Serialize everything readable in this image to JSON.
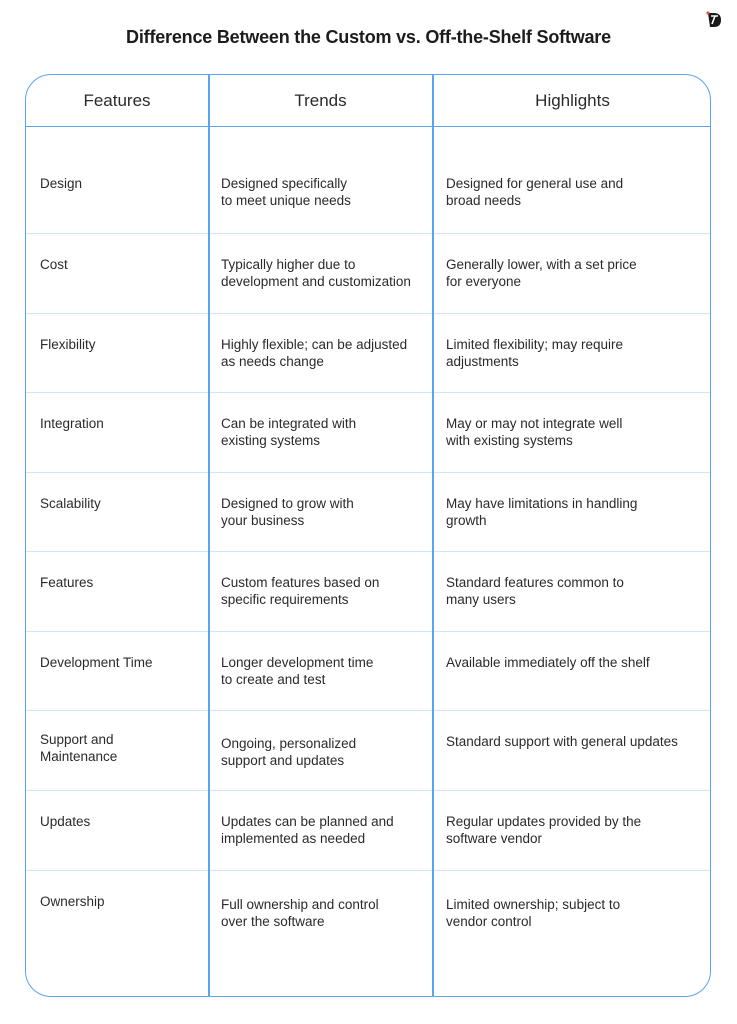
{
  "logo_icon": "brand-logo-icon",
  "title": "Difference Between the Custom vs. Off-the-Shelf Software",
  "columns": [
    "Features",
    "Trends",
    "Highlights"
  ],
  "rows": [
    {
      "feature": [
        "Design"
      ],
      "trend": [
        "Designed specifically",
        "to meet unique needs"
      ],
      "highlight": [
        "Designed for general use and",
        "broad needs"
      ]
    },
    {
      "feature": [
        "Cost"
      ],
      "trend": [
        "Typically higher due to",
        "development and customization"
      ],
      "highlight": [
        "Generally lower, with a set price",
        "for everyone"
      ]
    },
    {
      "feature": [
        "Flexibility"
      ],
      "trend": [
        "Highly flexible; can be adjusted",
        "as needs change"
      ],
      "highlight": [
        "Limited flexibility; may require",
        "adjustments"
      ]
    },
    {
      "feature": [
        "Integration"
      ],
      "trend": [
        "Can be integrated with",
        "existing systems"
      ],
      "highlight": [
        "May or may not integrate well",
        "with existing systems"
      ]
    },
    {
      "feature": [
        "Scalability"
      ],
      "trend": [
        "Designed to grow with",
        "your business"
      ],
      "highlight": [
        "May have limitations in handling",
        "growth"
      ]
    },
    {
      "feature": [
        "Features"
      ],
      "trend": [
        "Custom features based on",
        "specific requirements"
      ],
      "highlight": [
        "Standard features common to",
        "many users"
      ]
    },
    {
      "feature": [
        "Development Time"
      ],
      "trend": [
        "Longer development time",
        "to create and test"
      ],
      "highlight": [
        "Available immediately off the shelf"
      ]
    },
    {
      "feature": [
        "Support and",
        "Maintenance"
      ],
      "trend": [
        "Ongoing, personalized",
        "support and updates"
      ],
      "highlight": [
        "Standard support with general updates"
      ]
    },
    {
      "feature": [
        "Updates"
      ],
      "trend": [
        "Updates can be planned and",
        "implemented as needed"
      ],
      "highlight": [
        "Regular updates provided by the",
        "software vendor"
      ]
    },
    {
      "feature": [
        "Ownership"
      ],
      "trend": [
        "Full ownership and control",
        "over the software"
      ],
      "highlight": [
        "Limited ownership; subject to",
        "vendor control"
      ]
    }
  ],
  "colors": {
    "border": "#5aa5f0",
    "row_divider": "#cfe5fb",
    "logo_dot": "#e8553e"
  }
}
